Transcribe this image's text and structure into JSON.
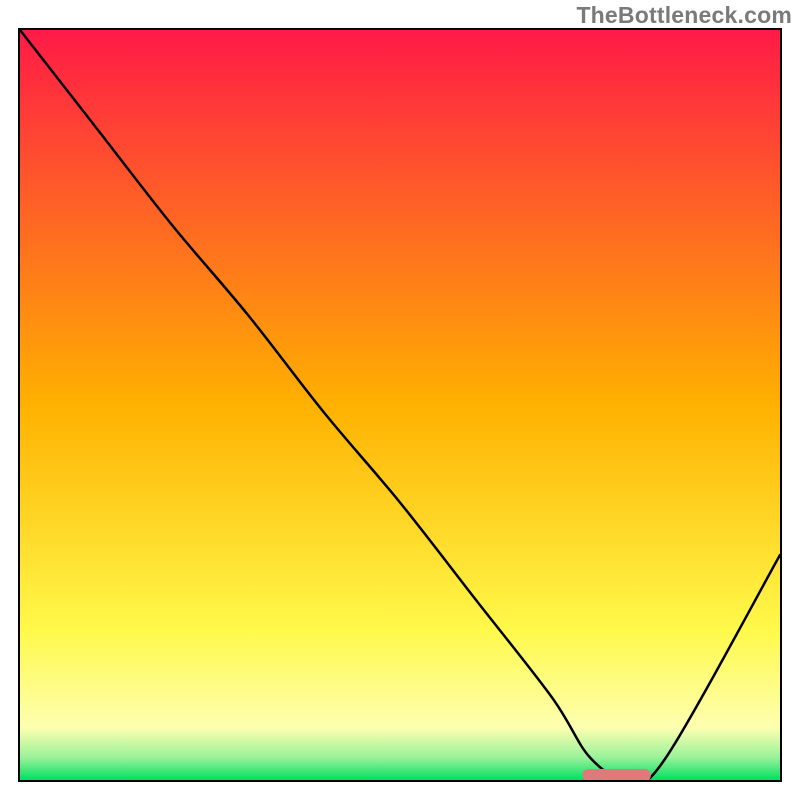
{
  "watermark": "TheBottleneck.com",
  "chart_data": {
    "type": "line",
    "title": "",
    "xlabel": "",
    "ylabel": "",
    "ylim": [
      0,
      100
    ],
    "xlim": [
      0,
      100
    ],
    "series": [
      {
        "name": "bottleneck-curve",
        "x": [
          0,
          10,
          20,
          30,
          40,
          50,
          60,
          70,
          75,
          80,
          85,
          100
        ],
        "y": [
          100,
          87,
          74,
          62,
          49,
          37,
          24,
          11,
          3,
          0,
          3,
          30
        ]
      }
    ],
    "marker": {
      "name": "optimal-range",
      "x_start": 74,
      "x_end": 83,
      "y": 0,
      "color": "#e07a7a"
    },
    "gradient": {
      "stops": [
        {
          "offset": 0.0,
          "color": "#ff1a47"
        },
        {
          "offset": 0.5,
          "color": "#ffb100"
        },
        {
          "offset": 0.8,
          "color": "#fff94a"
        },
        {
          "offset": 0.93,
          "color": "#fdffb0"
        },
        {
          "offset": 0.97,
          "color": "#9af29a"
        },
        {
          "offset": 1.0,
          "color": "#00e060"
        }
      ]
    }
  }
}
